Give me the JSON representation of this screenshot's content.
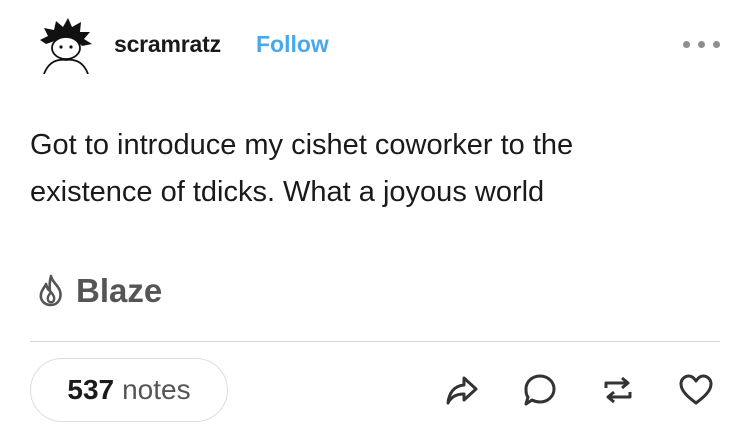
{
  "post": {
    "username": "scramratz",
    "follow_label": "Follow",
    "content_lines": [
      "Got to introduce my cishet coworker to the",
      "existence of tdicks. What a joyous world"
    ],
    "blaze_label": "Blaze",
    "notes_count": "537",
    "notes_label": "notes"
  },
  "icons": {
    "more": "more-options-icon",
    "blaze": "flame-icon",
    "share": "share-icon",
    "reply": "reply-icon",
    "reblog": "reblog-icon",
    "like": "heart-icon"
  },
  "colors": {
    "follow": "#4aa8ea",
    "text": "#1a1a1a",
    "muted": "#555555"
  }
}
